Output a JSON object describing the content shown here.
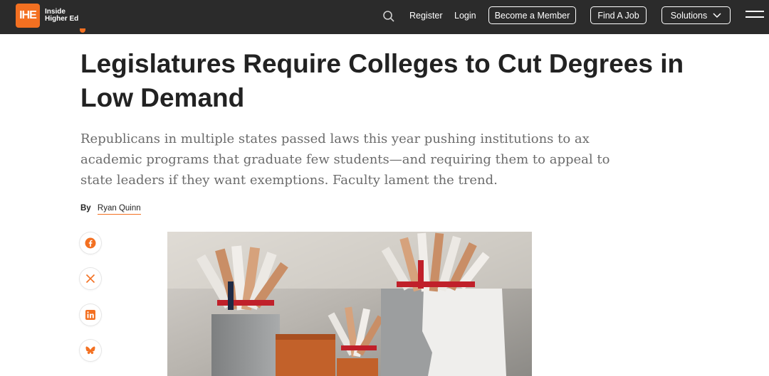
{
  "brand": {
    "logo_mark": "IHE",
    "logo_text": "Inside Higher Ed",
    "accent": "#f37021",
    "nav_bg": "#2b2b2b"
  },
  "nav": {
    "search_icon": "search-icon",
    "register": "Register",
    "login": "Login",
    "become_member": "Become a Member",
    "find_job": "Find A Job",
    "solutions": "Solutions",
    "menu_icon": "hamburger-menu-icon"
  },
  "article": {
    "headline": "Legislatures Require Colleges to Cut Degrees in Low Demand",
    "dek": "Republicans in multiple states passed laws this year pushing institutions to ax academic programs that graduate few students—and requiring them to appeal to state leaders if they want exemptions. Faculty lament the trend.",
    "byline_prefix": "By",
    "author": "Ryan Quinn"
  },
  "share": [
    {
      "name": "facebook",
      "icon": "facebook-icon"
    },
    {
      "name": "x",
      "icon": "x-icon"
    },
    {
      "name": "linkedin",
      "icon": "linkedin-icon"
    },
    {
      "name": "bluesky",
      "icon": "bluesky-icon"
    }
  ],
  "hero_image": {
    "description_icon": "diplomas-in-boxes-illustration"
  }
}
